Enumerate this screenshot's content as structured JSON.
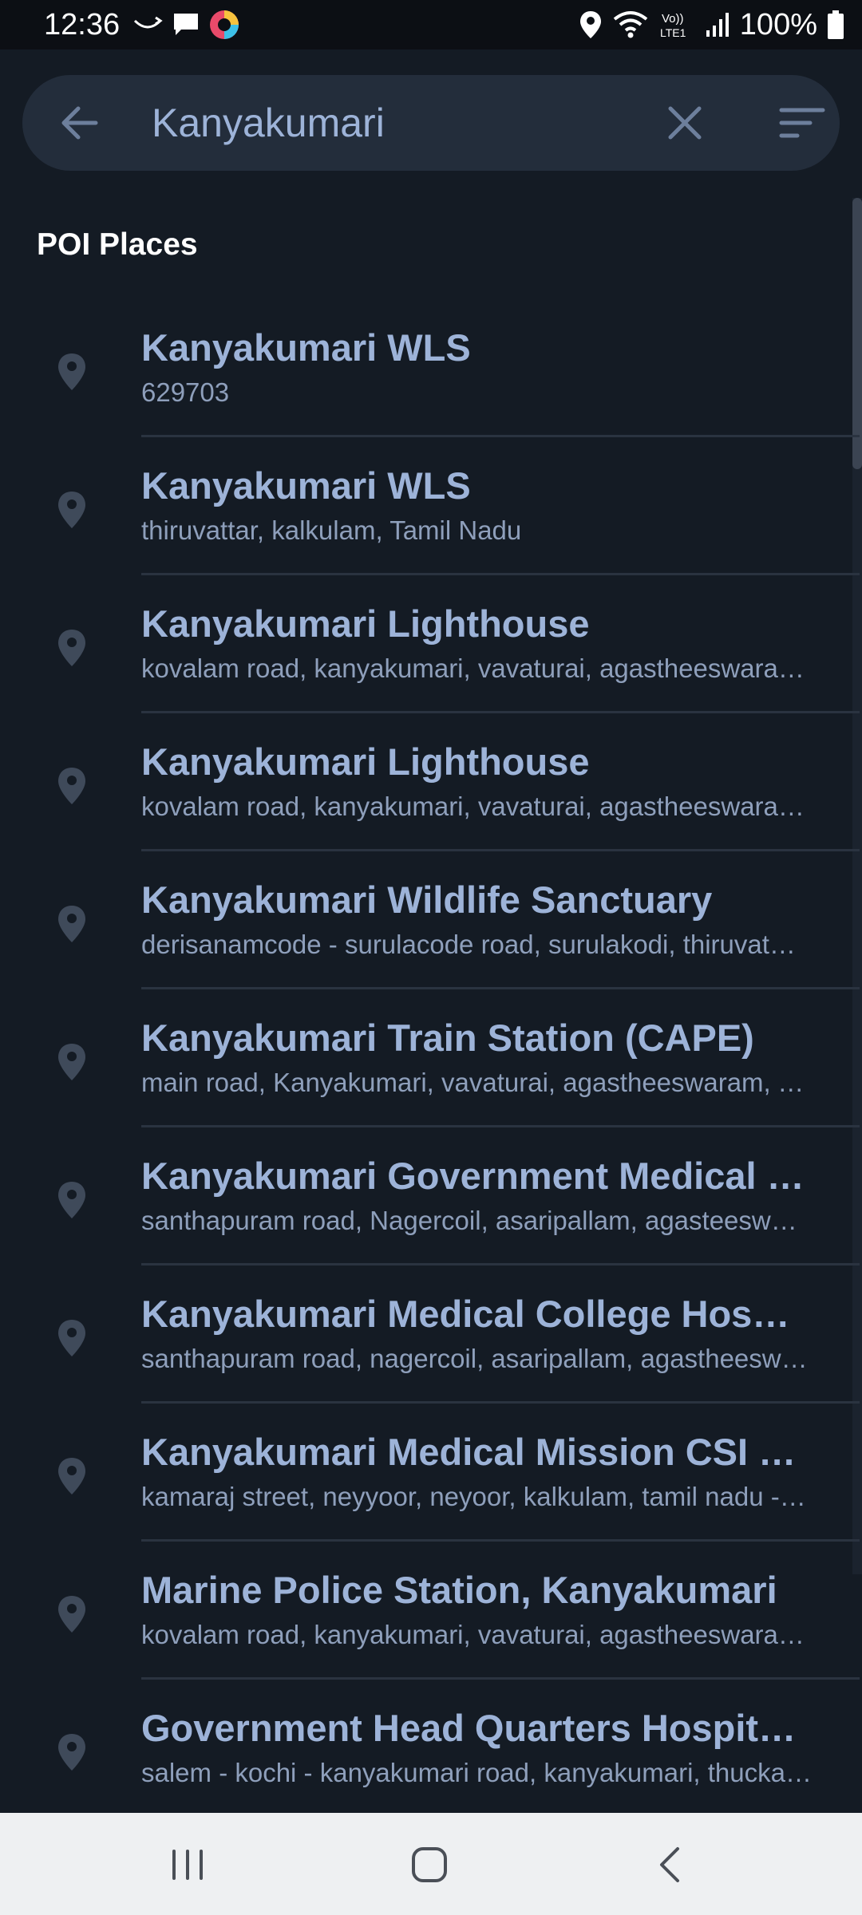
{
  "status_bar": {
    "time": "12:36",
    "battery": "100%",
    "left_icons": [
      "missed-call-icon",
      "message-icon",
      "app-icon"
    ],
    "right_icons": [
      "location-icon",
      "wifi-icon",
      "volte-icon",
      "signal-icon",
      "battery-icon"
    ],
    "volte_label_top": "Vo))",
    "volte_label_bottom": "LTE1"
  },
  "search": {
    "value": "Kanyakumari",
    "back_icon": "arrow-back-icon",
    "clear_icon": "close-icon",
    "filter_icon": "filter-icon"
  },
  "section": {
    "title": "POI Places"
  },
  "results": [
    {
      "title": "Kanyakumari WLS",
      "subtitle": "629703"
    },
    {
      "title": "Kanyakumari WLS",
      "subtitle": "thiruvattar, kalkulam, Tamil Nadu"
    },
    {
      "title": "Kanyakumari Lighthouse",
      "subtitle": "kovalam road, kanyakumari, vavaturai, agastheeswara…"
    },
    {
      "title": "Kanyakumari Lighthouse",
      "subtitle": "kovalam road, kanyakumari, vavaturai, agastheeswara…"
    },
    {
      "title": "Kanyakumari Wildlife Sanctuary",
      "subtitle": "derisanamcode - surulacode road, surulakodi, thiruvat…"
    },
    {
      "title": "Kanyakumari Train Station (CAPE)",
      "subtitle": "main road, Kanyakumari, vavaturai, agastheeswaram, T…"
    },
    {
      "title": "Kanyakumari Government Medical C…",
      "subtitle": "santhapuram road, Nagercoil, asaripallam, agasteesw…"
    },
    {
      "title": "Kanyakumari Medical College Hospit…",
      "subtitle": "santhapuram road, nagercoil, asaripallam, agastheesw…"
    },
    {
      "title": "Kanyakumari Medical Mission CSI H…",
      "subtitle": "kamaraj street, neyyoor, neyoor, kalkulam, tamil nadu -…"
    },
    {
      "title": "Marine Police Station, Kanyakumari",
      "subtitle": "kovalam road, kanyakumari, vavaturai, agastheeswara…"
    },
    {
      "title": "Government Head Quarters Hospital…",
      "subtitle": "salem - kochi - kanyakumari road, kanyakumari, thucka…"
    }
  ],
  "nav": {
    "recents_icon": "recent-apps-icon",
    "home_icon": "home-icon",
    "back_icon": "nav-back-icon"
  },
  "colors": {
    "background": "#141b24",
    "search_bar": "#232d3b",
    "accent_text": "#9db3d8",
    "status_bar": "#0c0f14",
    "nav_bar": "#eef0f2"
  }
}
